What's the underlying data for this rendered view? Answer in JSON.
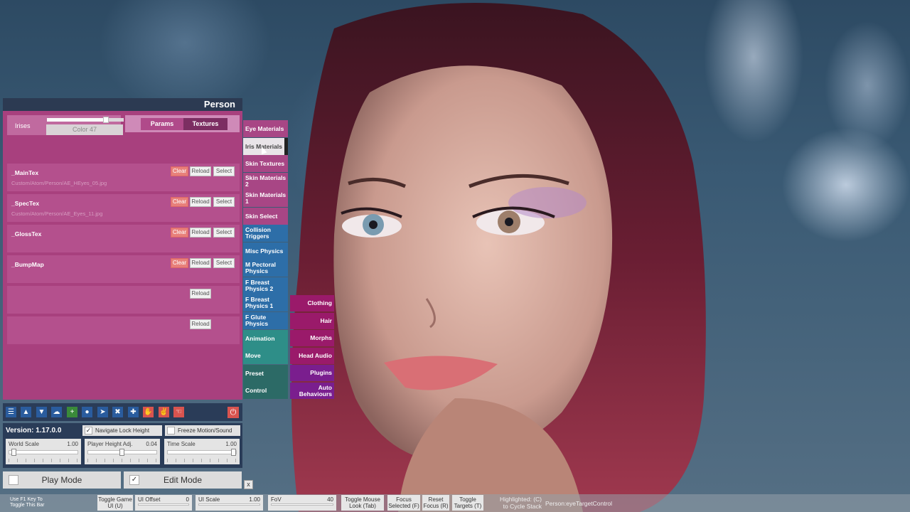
{
  "panel": {
    "title": "Person",
    "iris_label": "Irises",
    "iris_value": "Color 47",
    "iris_slider_fraction": 0.77,
    "tabs": [
      {
        "label": "Params"
      },
      {
        "label": "Textures"
      }
    ]
  },
  "textures": [
    {
      "name": "_MainTex",
      "path": "Custom/Atom/Person/AE_HEyes_05.jpg",
      "clear": "Clear",
      "reload": "Reload",
      "select": "Select"
    },
    {
      "name": "_SpecTex",
      "path": "Custom/Atom/Person/AE_Eyes_11.jpg",
      "clear": "Clear",
      "reload": "Reload",
      "select": "Select"
    },
    {
      "name": "_GlossTex",
      "path": "",
      "clear": "Clear",
      "reload": "Reload",
      "select": "Select"
    },
    {
      "name": "_BumpMap",
      "path": "",
      "clear": "Clear",
      "reload": "Reload",
      "select": "Select"
    },
    {
      "name": "",
      "path": "",
      "reload": "Reload"
    },
    {
      "name": "",
      "path": "",
      "reload": "Reload"
    }
  ],
  "menu_left": [
    {
      "label": "Eye Materials"
    },
    {
      "label": "Iris Materials"
    },
    {
      "label": "Skin Textures"
    },
    {
      "label": "Skin Materials 2"
    },
    {
      "label": "Skin Materials 1"
    },
    {
      "label": "Skin Select"
    },
    {
      "label": "Collision Triggers"
    },
    {
      "label": "Misc Physics"
    },
    {
      "label": "M Pectoral Physics"
    },
    {
      "label": "F Breast Physics 2"
    },
    {
      "label": "F Breast Physics 1"
    },
    {
      "label": "F Glute Physics"
    },
    {
      "label": "Animation"
    },
    {
      "label": "Move"
    },
    {
      "label": "Preset"
    },
    {
      "label": "Control"
    }
  ],
  "menu_right": [
    {
      "label": "Clothing"
    },
    {
      "label": "Hair"
    },
    {
      "label": "Morphs"
    },
    {
      "label": "Head Audio"
    },
    {
      "label": "Plugins"
    },
    {
      "label": "Auto Behaviours"
    }
  ],
  "toolbar": {
    "icons": [
      "menu-icon",
      "open-scene-icon",
      "save-scene-icon",
      "cloud-icon",
      "add-atom-icon",
      "person-icon",
      "select-icon",
      "tools-icon",
      "plus-icon",
      "hand-icon",
      "grab-hand-icon",
      "hand-point-icon"
    ],
    "power_icon": "power-icon"
  },
  "settings": {
    "version": "Version: 1.17.0.0",
    "navigate_lock_height": "Navigate Lock Height",
    "freeze_motion_sound": "Freeze Motion/Sound",
    "world_scale_label": "World Scale",
    "world_scale_value": "1.00",
    "player_height_label": "Player Height Adj.",
    "player_height_value": "0.04",
    "time_scale_label": "Time Scale",
    "time_scale_value": "1.00"
  },
  "modes": {
    "play": "Play Mode",
    "edit": "Edit Mode",
    "close": "x"
  },
  "statusbar": {
    "f1_hint": "Use F1 Key To Toggle This Bar",
    "toggle_game_ui": "Toggle Game UI (U)",
    "ui_offset_label": "UI Offset",
    "ui_offset_value": "0",
    "ui_scale_label": "UI Scale",
    "ui_scale_value": "1.00",
    "fov_label": "FoV",
    "fov_value": "40",
    "toggle_mouse_look": "Toggle Mouse Look (Tab)",
    "focus_selected": "Focus Selected (F)",
    "reset_focus": "Reset Focus (R)",
    "toggle_targets": "Toggle Targets (T)",
    "highlighted": "Highlighted: (C) to Cycle Stack",
    "highlight_target": "Person:eyeTargetControl"
  },
  "colors": {
    "panel_bg": "#a8407e",
    "header_bg": "#2c3a52",
    "menu_pink": "#a84685",
    "menu_blue": "#2d6ea8",
    "menu_teal": "#2e8e88",
    "menu_magenta": "#9a1a6a",
    "menu_purple": "#7a1e8e"
  }
}
